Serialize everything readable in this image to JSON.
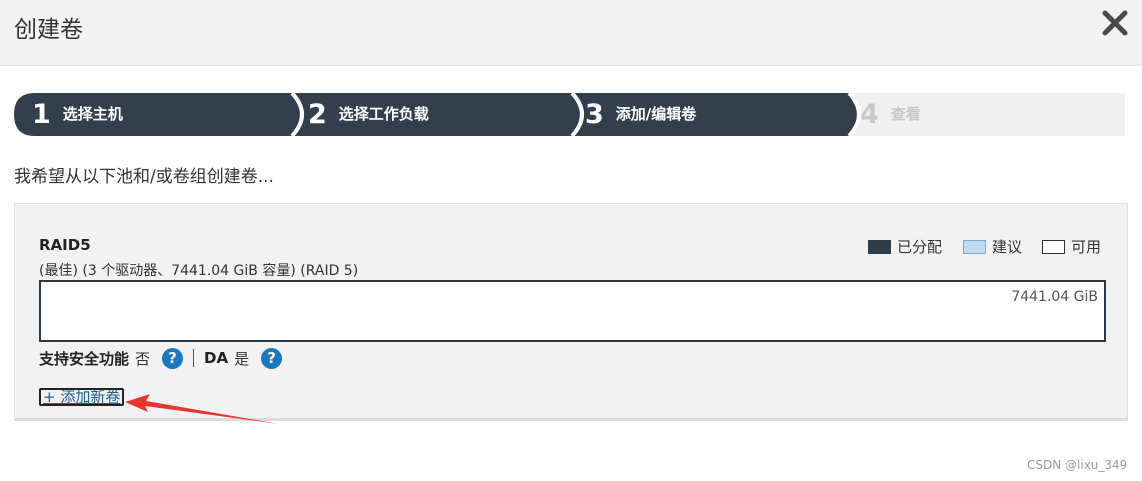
{
  "dialog": {
    "title": "创建卷",
    "close_icon": "close-icon"
  },
  "steps": [
    {
      "number": "1",
      "label": "选择主机",
      "state": "done"
    },
    {
      "number": "2",
      "label": "选择工作负载",
      "state": "done"
    },
    {
      "number": "3",
      "label": "添加/编辑卷",
      "state": "active"
    },
    {
      "number": "4",
      "label": "查看",
      "state": "inactive"
    }
  ],
  "intro_text": "我希望从以下池和/或卷组创建卷...",
  "pool": {
    "name": "RAID5",
    "details": "(最佳)  (3 个驱动器、7441.04 GiB 容量)  (RAID 5)",
    "capacity_label": "7441.04 GiB",
    "legend": [
      {
        "label": "已分配",
        "color": "#2f3d4b"
      },
      {
        "label": "建议",
        "color": "#bfdcf2"
      },
      {
        "label": "可用",
        "color": "#ffffff"
      }
    ],
    "security_label": "支持安全功能",
    "security_value": "否",
    "da_label": "DA",
    "da_value": "是",
    "help_icon_text": "?",
    "add_volume_link": "+ 添加新卷"
  },
  "colors": {
    "step_dark": "#323f4c",
    "step_inactive": "#f0f0f0",
    "accent": "#1a78c2",
    "arrow": "#e8352e"
  },
  "watermark": "CSDN @lixu_349"
}
